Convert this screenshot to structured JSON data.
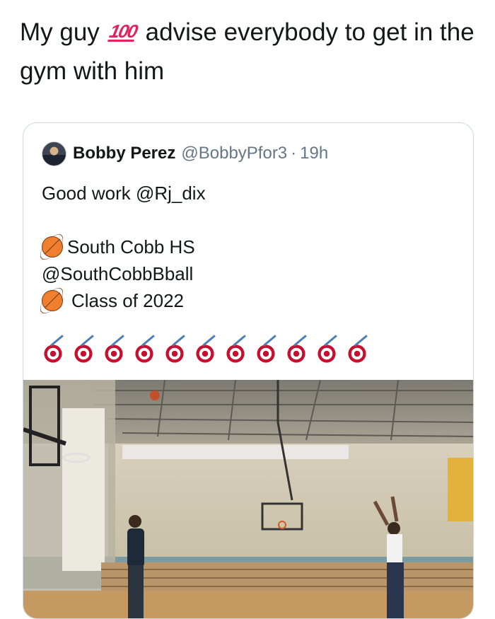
{
  "tweet": {
    "text_before": "My guy",
    "emoji": "100",
    "text_after": "advise everybody to get in the gym with him"
  },
  "quoted_tweet": {
    "name": "Bobby Perez",
    "handle": "@BobbyPfor3",
    "separator": "·",
    "time": "19h",
    "lines": [
      "Good work @Rj_dix",
      "",
      "South Cobb HS",
      "@SouthCobbBball",
      "Class of 2022"
    ],
    "target_count": 11
  },
  "icons": {
    "avatar": "profile-photo",
    "basketball": "basketball-icon",
    "target": "direct-hit-icon"
  },
  "colors": {
    "text": "#14171a",
    "secondary": "#657786",
    "border": "#cfd9de"
  }
}
